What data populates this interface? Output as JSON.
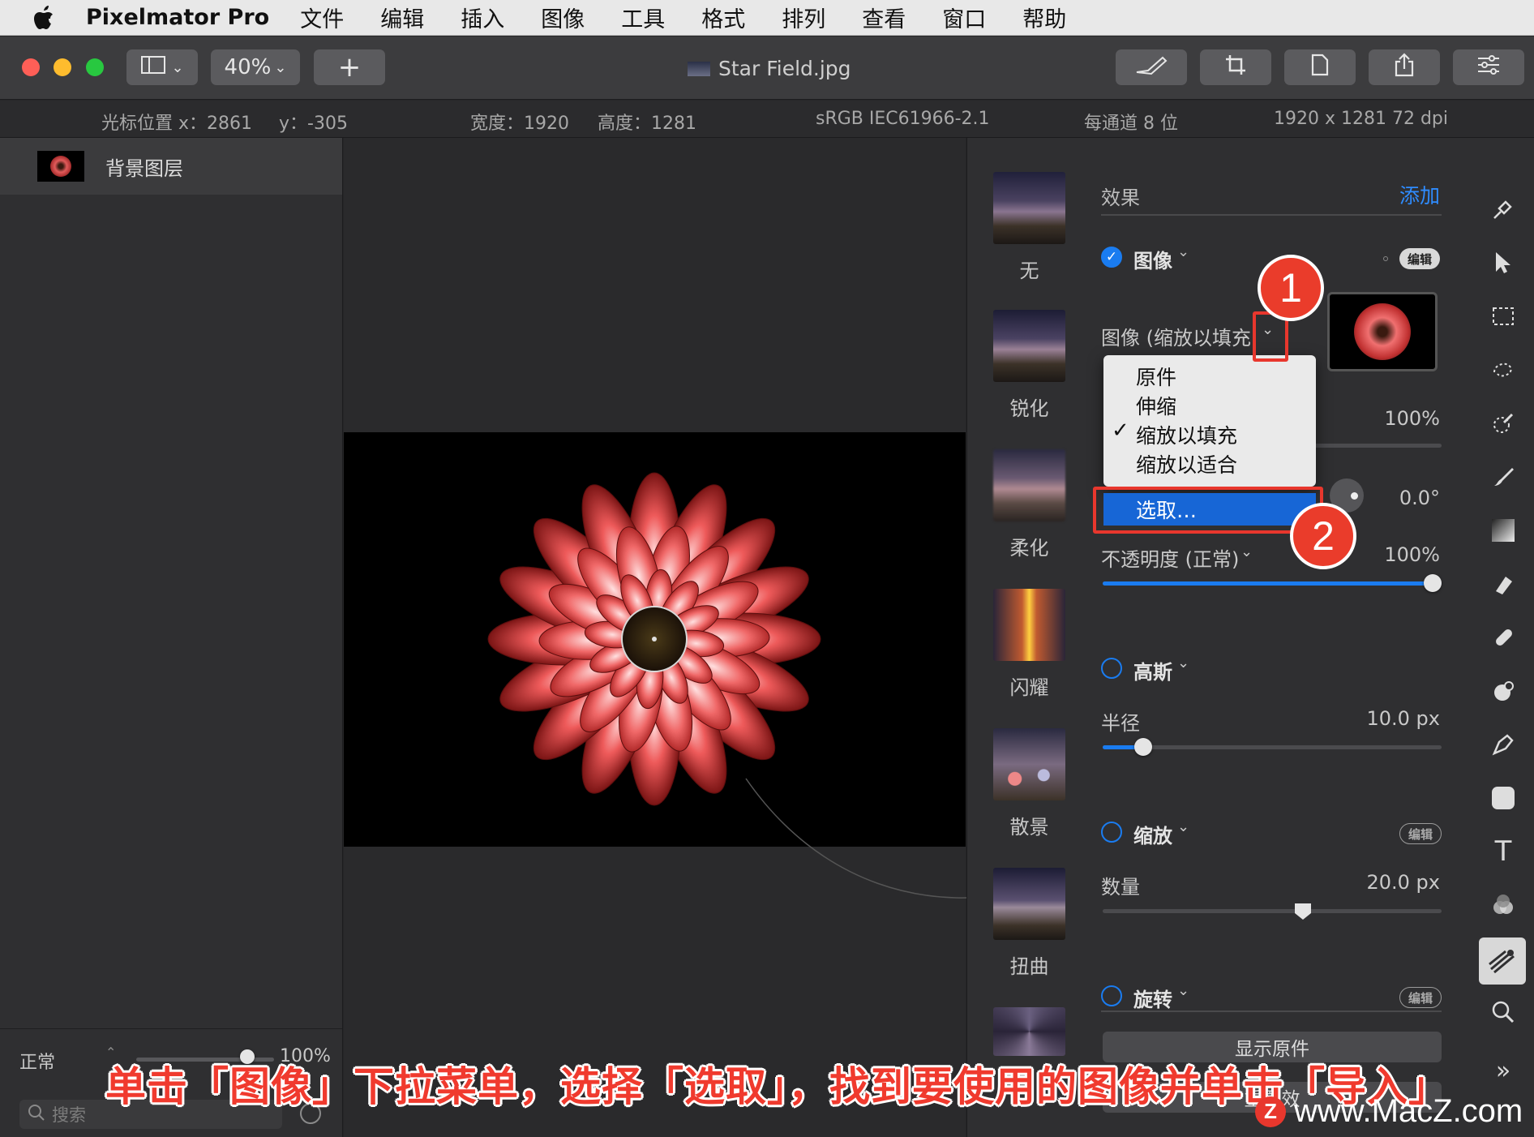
{
  "menubar": {
    "app_name": "Pixelmator Pro",
    "items": [
      "文件",
      "编辑",
      "插入",
      "图像",
      "工具",
      "格式",
      "排列",
      "查看",
      "窗口",
      "帮助"
    ]
  },
  "toolbar": {
    "zoom": "40%",
    "add_label": "+",
    "doc_title": "Star Field.jpg",
    "traffic_colors": [
      "#fe5f57",
      "#febc2e",
      "#28c840"
    ]
  },
  "infobar": {
    "cursor_x": "光标位置 x：2861",
    "cursor_y": "y：-305",
    "width": "宽度：1920",
    "height": "高度：1281",
    "color_profile": "sRGB IEC61966-2.1",
    "bit_depth": "每通道 8 位",
    "dimensions": "1920 x 1281 72 dpi"
  },
  "layers": {
    "items": [
      {
        "name": "背景图层"
      }
    ],
    "blend_mode": "正常",
    "opacity": "100%",
    "search_placeholder": "搜索"
  },
  "effects_browser": [
    {
      "label": "无",
      "icon": "mountain-thumb"
    },
    {
      "label": "锐化",
      "icon": "mountain-thumb"
    },
    {
      "label": "柔化",
      "icon": "blur-thumb"
    },
    {
      "label": "闪耀",
      "icon": "glow-thumb"
    },
    {
      "label": "散景",
      "icon": "bokeh-thumb"
    },
    {
      "label": "扭曲",
      "icon": "distort-thumb"
    }
  ],
  "inspector": {
    "section_title": "效果",
    "add_label": "添加",
    "image_effect": {
      "title": "图像",
      "edit": "编辑",
      "image_mode_label": "图像 (缩放以填充",
      "opacity_value": "100%",
      "angle_value": "0.0°",
      "opacity_label": "不透明度 (正常)",
      "opacity2_value": "100%",
      "opacity2_level": 1.0
    },
    "gaussian": {
      "title": "高斯",
      "radius_label": "半径",
      "radius_value": "10.0 px",
      "radius_level": 0.12
    },
    "zoom": {
      "title": "缩放",
      "edit": "编辑",
      "amount_label": "数量",
      "amount_value": "20.0 px",
      "amount_level": 0.59
    },
    "rotate": {
      "title": "旋转",
      "edit": "编辑"
    },
    "show_original": "显示原件",
    "truncated_button": "重置效"
  },
  "dropdown": {
    "options": [
      "原件",
      "伸缩",
      "缩放以填充",
      "缩放以适合"
    ],
    "checked_index": 2,
    "pick_label": "选取…"
  },
  "annotations": {
    "badge1": "1",
    "badge2": "2",
    "caption": "单击「图像」下拉菜单，选择「选取」，找到要使用的图像并单击「导入」",
    "watermark": "www.MacZ.com",
    "watermark_logo": "Z",
    "accent": "#ea3c2b"
  }
}
